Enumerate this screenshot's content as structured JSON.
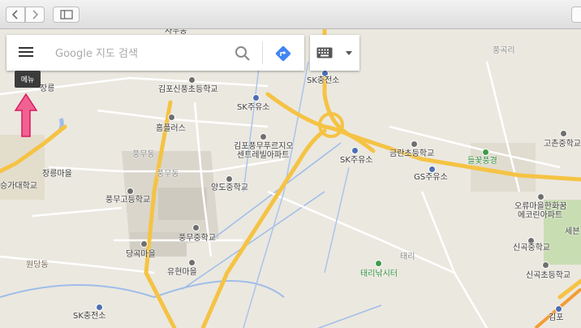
{
  "search": {
    "placeholder": "Google 지도 검색"
  },
  "tooltip": {
    "menu": "메뉴"
  },
  "colors": {
    "arrow": "#f06292",
    "directions": "#4285f4",
    "highway": "#f5c344",
    "road": "#ffffff",
    "water": "#9fbde8",
    "park": "#c9ddb3"
  },
  "icons": {
    "back": "chevron-left-icon",
    "forward": "chevron-right-icon",
    "sidebar": "sidebar-icon",
    "menu": "hamburger-icon",
    "search": "search-icon",
    "directions": "directions-icon",
    "keyboard": "keyboard-icon",
    "dropdown": "caret-down-icon"
  },
  "labels": {
    "top_cut": "사무동",
    "yangneung": "장릉",
    "gimpo_sinpung": "김포신풍초등학교",
    "sk_top": "SK충전소",
    "sk_juyuso1": "SK주유소",
    "pungmu_prugio": "김포풍무푸르지오",
    "centrebill": "센트레빌아파트",
    "homeplus": "홈플러스",
    "pungmudong": "풍무동",
    "pungmudong2": "풍무동",
    "jangneung_village": "장릉마을",
    "seunga_school": "승가대학교",
    "pungmu_high": "풍무고등학교",
    "yangdo_middle": "양도중학교",
    "pungmu_middle": "풍무중학교",
    "dangok": "당곡마을",
    "yuhyeon": "유현마을",
    "wondang": "원당동",
    "sk_bottom": "SK충전소",
    "sk_juyuso2": "SK주유소",
    "geumran": "금란초등학교",
    "gs_juyuso": "GS주유소",
    "pungokri": "풍곡리",
    "gochon_middle": "고촌중학교",
    "teulkkot": "들꽃풍경",
    "orido_hanyang": "오류마을한화꿈",
    "eco_apt": "에코린아파트",
    "sebit": "세븐",
    "singok_middle": "신곡중학교",
    "singok_elem": "신곡초등학교",
    "taeri": "태리",
    "taeri_fishing": "태리낚시터",
    "gimpo_bottom": "김포"
  }
}
